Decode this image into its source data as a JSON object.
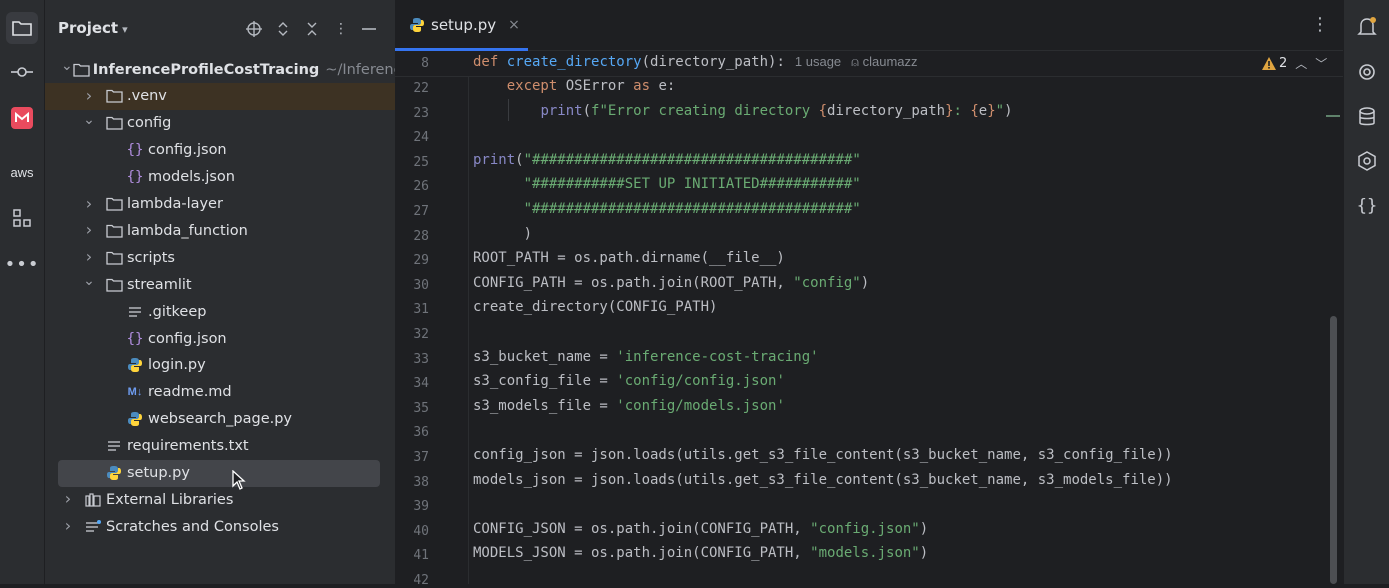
{
  "project_panel": {
    "title": "Project",
    "tree": [
      {
        "name": "InferenceProfileCostTracing",
        "hint": "~/Inference",
        "type": "folder",
        "expanded": true,
        "depth": 0,
        "bold": true
      },
      {
        "name": ".venv",
        "type": "folder",
        "expanded": false,
        "depth": 1,
        "excluded": true
      },
      {
        "name": "config",
        "type": "folder",
        "expanded": true,
        "depth": 1
      },
      {
        "name": "config.json",
        "type": "json",
        "depth": 2
      },
      {
        "name": "models.json",
        "type": "json",
        "depth": 2
      },
      {
        "name": "lambda-layer",
        "type": "folder",
        "expanded": false,
        "depth": 1
      },
      {
        "name": "lambda_function",
        "type": "folder",
        "expanded": false,
        "depth": 1
      },
      {
        "name": "scripts",
        "type": "folder",
        "expanded": false,
        "depth": 1
      },
      {
        "name": "streamlit",
        "type": "folder",
        "expanded": true,
        "depth": 1
      },
      {
        "name": ".gitkeep",
        "type": "text",
        "depth": 2
      },
      {
        "name": "config.json",
        "type": "json",
        "depth": 2
      },
      {
        "name": "login.py",
        "type": "python",
        "depth": 2
      },
      {
        "name": "readme.md",
        "type": "markdown",
        "depth": 2
      },
      {
        "name": "websearch_page.py",
        "type": "python",
        "depth": 2
      },
      {
        "name": "requirements.txt",
        "type": "text",
        "depth": 1
      },
      {
        "name": "setup.py",
        "type": "python",
        "depth": 1,
        "selected": true
      },
      {
        "name": "External Libraries",
        "type": "library",
        "expanded": false,
        "depth": 0
      },
      {
        "name": "Scratches and Consoles",
        "type": "scratch",
        "expanded": false,
        "depth": 0
      }
    ]
  },
  "editor": {
    "tab_label": "setup.py",
    "tab_close": "×",
    "more": "⋮",
    "sticky": {
      "line_no": "8",
      "def_kw": "def",
      "fn_name": "create_directory",
      "params": "(directory_path):",
      "usage": "1 usage",
      "author": "claumazz"
    },
    "warnings_count": "2",
    "lines": [
      {
        "no": "22",
        "segs": [
          [
            "p",
            "    "
          ],
          [
            "k",
            "except"
          ],
          [
            "p",
            " OSError "
          ],
          [
            "k",
            "as"
          ],
          [
            "p",
            " e:"
          ]
        ]
      },
      {
        "no": "23",
        "segs": [
          [
            "p",
            "        "
          ],
          [
            "b",
            "print"
          ],
          [
            "p",
            "("
          ],
          [
            "s",
            "f\"Error creating directory "
          ],
          [
            "k",
            "{"
          ],
          [
            "p",
            "directory_path"
          ],
          [
            "k",
            "}"
          ],
          [
            "s",
            ": "
          ],
          [
            "k",
            "{"
          ],
          [
            "p",
            "e"
          ],
          [
            "k",
            "}"
          ],
          [
            "s",
            "\""
          ],
          [
            "p",
            ")"
          ]
        ]
      },
      {
        "no": "24",
        "segs": []
      },
      {
        "no": "25",
        "segs": [
          [
            "b",
            "print"
          ],
          [
            "p",
            "("
          ],
          [
            "s",
            "\"######################################\""
          ]
        ]
      },
      {
        "no": "26",
        "segs": [
          [
            "p",
            "      "
          ],
          [
            "s",
            "\"###########SET UP INITIATED###########\""
          ]
        ]
      },
      {
        "no": "27",
        "segs": [
          [
            "p",
            "      "
          ],
          [
            "s",
            "\"######################################\""
          ]
        ]
      },
      {
        "no": "28",
        "segs": [
          [
            "p",
            "      )"
          ]
        ]
      },
      {
        "no": "29",
        "segs": [
          [
            "p",
            "ROOT_PATH = os.path.dirname(__file__)"
          ]
        ]
      },
      {
        "no": "30",
        "segs": [
          [
            "p",
            "CONFIG_PATH = os.path.join(ROOT_PATH, "
          ],
          [
            "s",
            "\"config\""
          ],
          [
            "p",
            ")"
          ]
        ]
      },
      {
        "no": "31",
        "segs": [
          [
            "p",
            "create_directory(CONFIG_PATH)"
          ]
        ]
      },
      {
        "no": "32",
        "segs": []
      },
      {
        "no": "33",
        "segs": [
          [
            "p",
            "s3_bucket_name = "
          ],
          [
            "s",
            "'inference-cost-tracing'"
          ]
        ]
      },
      {
        "no": "34",
        "segs": [
          [
            "p",
            "s3_config_file = "
          ],
          [
            "s",
            "'config/config.json'"
          ]
        ]
      },
      {
        "no": "35",
        "segs": [
          [
            "p",
            "s3_models_file = "
          ],
          [
            "s",
            "'config/models.json'"
          ]
        ]
      },
      {
        "no": "36",
        "segs": []
      },
      {
        "no": "37",
        "segs": [
          [
            "p",
            "config_json = json.loads(utils.get_s3_file_content(s3_bucket_name, s3_config_file))"
          ]
        ]
      },
      {
        "no": "38",
        "segs": [
          [
            "p",
            "models_json = json.loads(utils.get_s3_file_content(s3_bucket_name, s3_models_file))"
          ]
        ]
      },
      {
        "no": "39",
        "segs": []
      },
      {
        "no": "40",
        "segs": [
          [
            "p",
            "CONFIG_JSON = os.path.join(CONFIG_PATH, "
          ],
          [
            "s",
            "\"config.json\""
          ],
          [
            "p",
            ")"
          ]
        ]
      },
      {
        "no": "41",
        "segs": [
          [
            "p",
            "MODELS_JSON = os.path.join(CONFIG_PATH, "
          ],
          [
            "s",
            "\"models.json\""
          ],
          [
            "p",
            ")"
          ]
        ]
      },
      {
        "no": "42",
        "segs": []
      }
    ]
  },
  "left_toolbar": [
    "folder-icon",
    "commit-icon",
    "jetbrains-ai-icon",
    "aws-icon",
    "structure-icon",
    "more-icon"
  ],
  "left_toolbar_aws_label": "aws",
  "right_toolbar": [
    "notifications-icon",
    "ai-assistant-icon",
    "database-icon",
    "plugin-icon",
    "json-icon"
  ],
  "colors": {
    "accent": "#3574f0",
    "keyword": "#cf8e6d",
    "function": "#56a8f5",
    "string": "#6aab73",
    "builtin": "#8888c6",
    "warning": "#e0a540"
  }
}
